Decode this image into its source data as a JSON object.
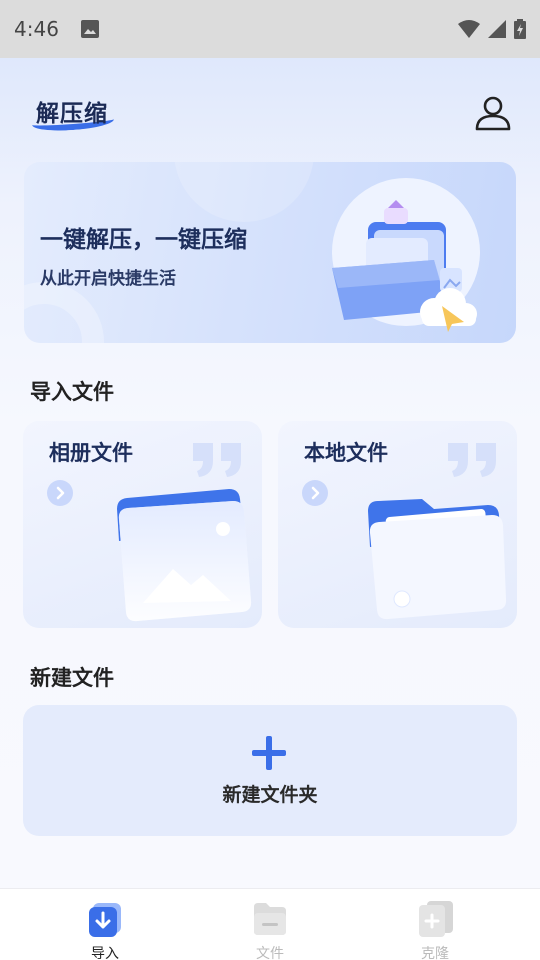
{
  "status_bar": {
    "time": "4:46",
    "icons": [
      "image-icon",
      "wifi-icon",
      "signal-icon",
      "battery-icon"
    ]
  },
  "header": {
    "app_title": "解压缩",
    "profile_icon": "user-icon"
  },
  "banner": {
    "title": "一键解压，一键压缩",
    "subtitle": "从此开启快捷生活"
  },
  "import_section": {
    "title": "导入文件",
    "cards": [
      {
        "label": "相册文件",
        "icon": "photo-album-icon"
      },
      {
        "label": "本地文件",
        "icon": "folder-icon"
      }
    ]
  },
  "new_section": {
    "title": "新建文件",
    "button_label": "新建文件夹",
    "button_icon": "plus-icon"
  },
  "bottom_nav": {
    "items": [
      {
        "label": "导入",
        "icon": "import-icon",
        "active": true
      },
      {
        "label": "文件",
        "icon": "files-icon",
        "active": false
      },
      {
        "label": "克隆",
        "icon": "clone-icon",
        "active": false
      }
    ]
  },
  "colors": {
    "accent": "#3a6ee8",
    "card_bg": "#e4ebfc",
    "title_text": "#1d2e5c",
    "nav_inactive": "#bbbbbb"
  }
}
